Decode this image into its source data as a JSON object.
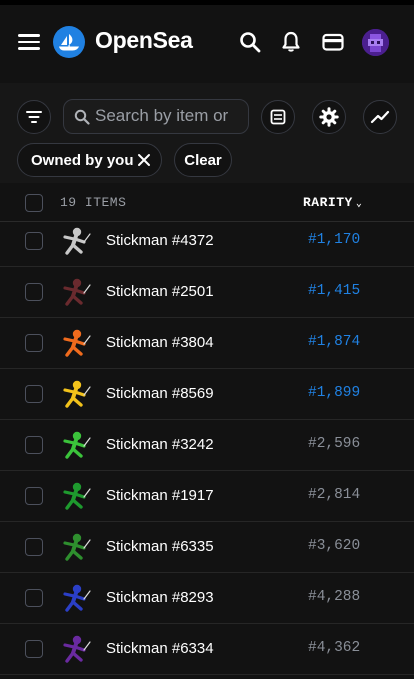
{
  "app": {
    "name": "OpenSea"
  },
  "search": {
    "placeholder": "Search by item or"
  },
  "filters": {
    "chips": [
      {
        "label": "Owned by you"
      },
      {
        "label": "Clear"
      }
    ]
  },
  "list": {
    "count_label": "19 ITEMS",
    "sort_label": "RARITY",
    "items": [
      {
        "name": "Stickman #4372",
        "rank": "#1,170",
        "highlight": true,
        "color": "#c8c8c8"
      },
      {
        "name": "Stickman #2501",
        "rank": "#1,415",
        "highlight": true,
        "color": "#6a2a2e"
      },
      {
        "name": "Stickman #3804",
        "rank": "#1,874",
        "highlight": true,
        "color": "#f06b1d"
      },
      {
        "name": "Stickman #8569",
        "rank": "#1,899",
        "highlight": true,
        "color": "#f2c21b"
      },
      {
        "name": "Stickman #3242",
        "rank": "#2,596",
        "highlight": false,
        "color": "#3bc33b"
      },
      {
        "name": "Stickman #1917",
        "rank": "#2,814",
        "highlight": false,
        "color": "#1e9a2e"
      },
      {
        "name": "Stickman #6335",
        "rank": "#3,620",
        "highlight": false,
        "color": "#2e8f2e"
      },
      {
        "name": "Stickman #8293",
        "rank": "#4,288",
        "highlight": false,
        "color": "#2b3fc7"
      },
      {
        "name": "Stickman #6334",
        "rank": "#4,362",
        "highlight": false,
        "color": "#6a2aa0"
      }
    ]
  },
  "colors": {
    "accent": "#2081e2",
    "background": "#121212",
    "muted": "#8a8f98"
  }
}
